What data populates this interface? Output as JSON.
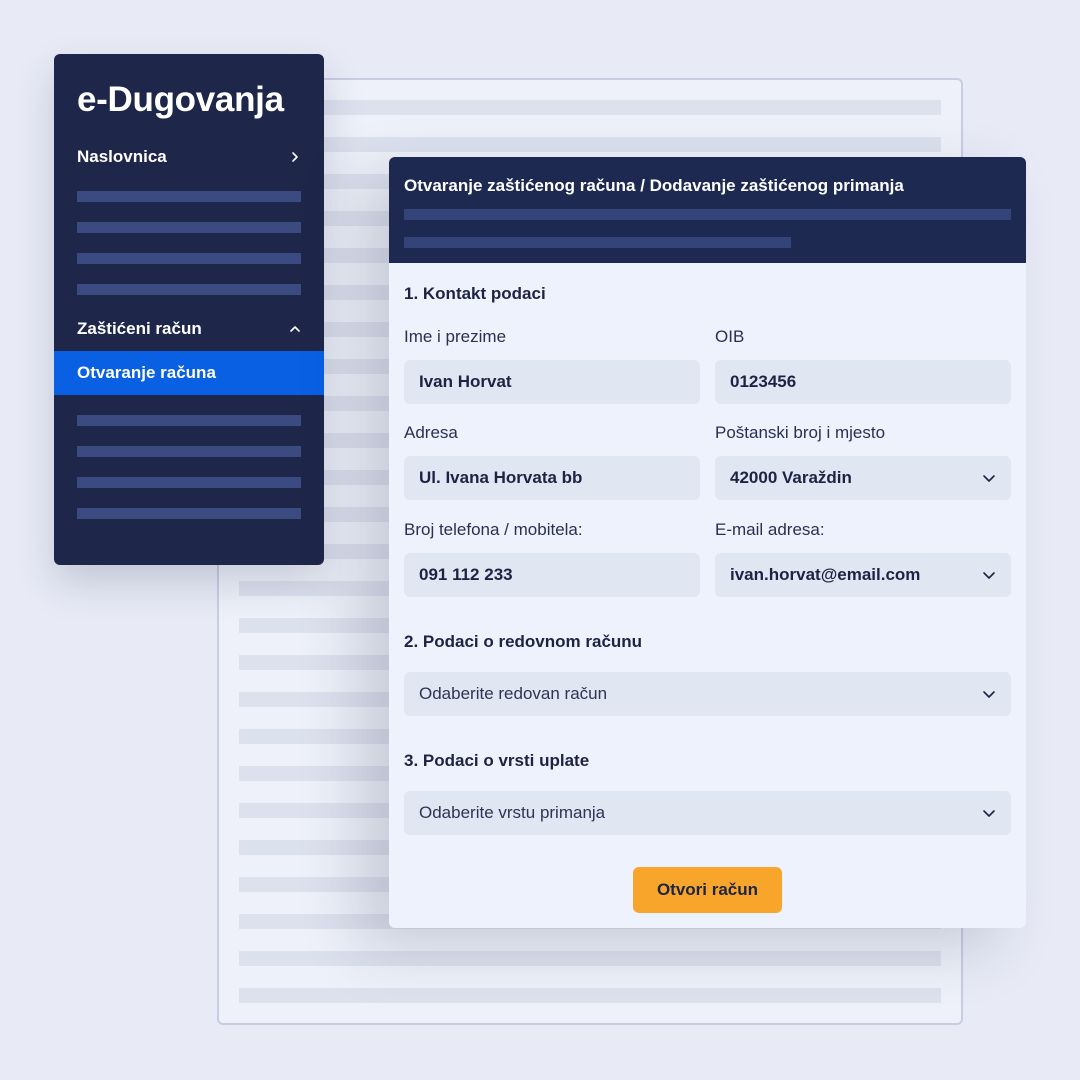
{
  "colors": {
    "page_background": "#e8ebf6",
    "sidebar_background": "#1e2749",
    "sidebar_active": "#0960e3",
    "card_header": "#1d2950",
    "submit_button": "#f7a62b"
  },
  "sidebar": {
    "logo": "e-Dugovanja",
    "items": [
      {
        "label": "Naslovnica",
        "icon": "chevron-right-icon"
      },
      {
        "label": "Zaštićeni račun",
        "icon": "chevron-up-icon"
      }
    ],
    "active_item": "Otvaranje računa"
  },
  "form": {
    "title": "Otvaranje zaštićenog računa / Dodavanje zaštićenog primanja",
    "section_contact": "1. Kontakt podaci",
    "fields": {
      "name": {
        "label": "Ime i prezime",
        "value": "Ivan Horvat"
      },
      "oib": {
        "label": "OIB",
        "value": "0123456"
      },
      "address": {
        "label": "Adresa",
        "value": "Ul. Ivana Horvata bb"
      },
      "postal": {
        "label": "Poštanski broj i mjesto",
        "value": "42000 Varaždin"
      },
      "phone": {
        "label": "Broj telefona / mobitela:",
        "value": "091 112 233"
      },
      "email": {
        "label": "E-mail adresa:",
        "value": "ivan.horvat@email.com"
      }
    },
    "section_account": "2. Podaci o redovnom računu",
    "account_placeholder": "Odaberite redovan račun",
    "section_payment": "3. Podaci o vrsti uplate",
    "payment_placeholder": "Odaberite vrstu primanja",
    "submit_label": "Otvori račun"
  }
}
